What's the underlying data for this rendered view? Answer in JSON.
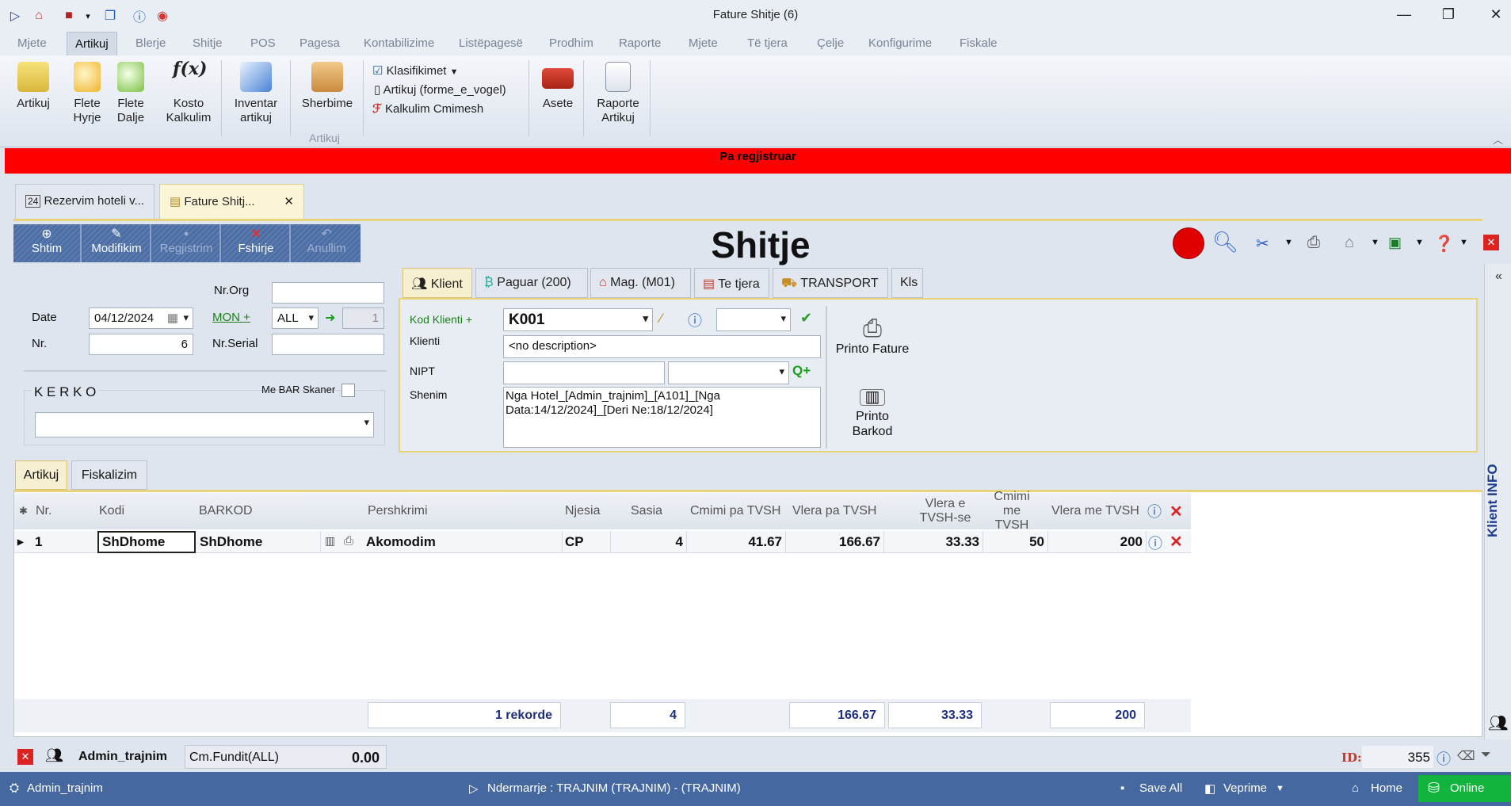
{
  "window": {
    "title": "Fature Shitje (6)"
  },
  "menu": [
    "Mjete",
    "Artikuj",
    "Blerje",
    "Shitje",
    "POS",
    "Pagesa",
    "Kontabilizime",
    "Listëpagesë",
    "Prodhim",
    "Raporte",
    "Mjete",
    "Të tjera",
    "Çelje",
    "Konfigurime",
    "Fiskale"
  ],
  "ribbon": {
    "artikuj": "Artikuj",
    "flete_hyrje_1": "Flete",
    "flete_hyrje_2": "Hyrje",
    "flete_dalje_1": "Flete",
    "flete_dalje_2": "Dalje",
    "kosto_1": "Kosto",
    "kosto_2": "Kalkulim",
    "inventar_1": "Inventar",
    "inventar_2": "artikuj",
    "sherbime": "Sherbime",
    "klasifikimet": "Klasifikimet",
    "artikuj_forme": "Artikuj (forme_e_vogel)",
    "kalkulim_cmimesh": "Kalkulim Cmimesh",
    "asete": "Asete",
    "raporte_1": "Raporte",
    "raporte_2": "Artikuj",
    "group_label": "Artikuj"
  },
  "status_banner": "Pa regjistruar",
  "doc_tabs": {
    "tab1": "Rezervim hoteli v...",
    "tab2": "Fature Shitj..."
  },
  "toolbar": {
    "shtim": "Shtim",
    "modifikim": "Modifikim",
    "regjistrim": "Regjistrim",
    "fshirje": "Fshirje",
    "anullim": "Anullim"
  },
  "page_title": "Shitje",
  "form": {
    "nrorg_label": "Nr.Org",
    "date_label": "Date",
    "date_value": "04/12/2024",
    "mon_label": "MON +",
    "mon_value": "ALL",
    "rate_value": "1",
    "nr_label": "Nr.",
    "nr_value": "6",
    "nrserial_label": "Nr.Serial",
    "kerko_label": "K E R K O",
    "bar_skaner_label": "Me BAR Skaner"
  },
  "client_tabs": {
    "klient": "Klient",
    "paguar": "Paguar (200)",
    "mag": "Mag. (M01)",
    "te_tjera": "Te tjera",
    "transport": "TRANSPORT",
    "kls": "Kls"
  },
  "client": {
    "kod_label": "Kod Klienti +",
    "kod_value": "K001",
    "klienti_label": "Klienti",
    "klienti_value": "<no description>",
    "nipt_label": "NIPT",
    "shenim_label": "Shenim",
    "shenim_value": "Nga Hotel_[Admin_trajnim]_[A101]_[Nga Data:14/12/2024]_[Deri Ne:18/12/2024]",
    "printo_fature": "Printo Fature",
    "printo_barkod_1": "Printo",
    "printo_barkod_2": "Barkod",
    "q_plus": "Q+"
  },
  "grid_tabs": {
    "artikuj": "Artikuj",
    "fiskalizim": "Fiskalizim"
  },
  "grid": {
    "columns": {
      "nr": "Nr.",
      "kodi": "Kodi",
      "barkod": "BARKOD",
      "pershkrimi": "Pershkrimi",
      "njesia": "Njesia",
      "sasia": "Sasia",
      "cmimi_pa": "Cmimi pa TVSH",
      "vlera_pa": "Vlera pa TVSH",
      "vlera_e_1": "Vlera e",
      "vlera_e_2": "TVSH-se",
      "cmimi_me_1": "Cmimi me",
      "cmimi_me_2": "TVSH",
      "vlera_me": "Vlera me TVSH"
    },
    "rows": [
      {
        "nr": "1",
        "kodi": "ShDhome",
        "barkod": "ShDhome",
        "pershkrimi": "Akomodim",
        "njesia": "CP",
        "sasia": "4",
        "cmimi_pa": "41.67",
        "vlera_pa": "166.67",
        "vlera_tvsh": "33.33",
        "cmimi_me": "50",
        "vlera_me": "200"
      }
    ],
    "totals": {
      "rekorde": "1 rekorde",
      "sasia": "4",
      "vlera_pa": "166.67",
      "vlera_tvsh": "33.33",
      "vlera_me": "200"
    }
  },
  "footer": {
    "user": "Admin_trajnim",
    "cm_fundit_label": "Cm.Fundit(ALL)",
    "cm_fundit_value": "0.00",
    "id_label": "ID:",
    "id_value": "355"
  },
  "side_panel": "Klient INFO",
  "appstatus": {
    "user": "Admin_trajnim",
    "ndermarrje": "Ndermarrje : TRAJNIM (TRAJNIM) - (TRAJNIM)",
    "save_all": "Save All",
    "veprime": "Veprime",
    "home": "Home",
    "online": "Online"
  },
  "colors": {
    "banner": "#ff0000",
    "toolbar": "#4d6fa3",
    "online": "#13b43d",
    "record_dot": "#e00000"
  }
}
